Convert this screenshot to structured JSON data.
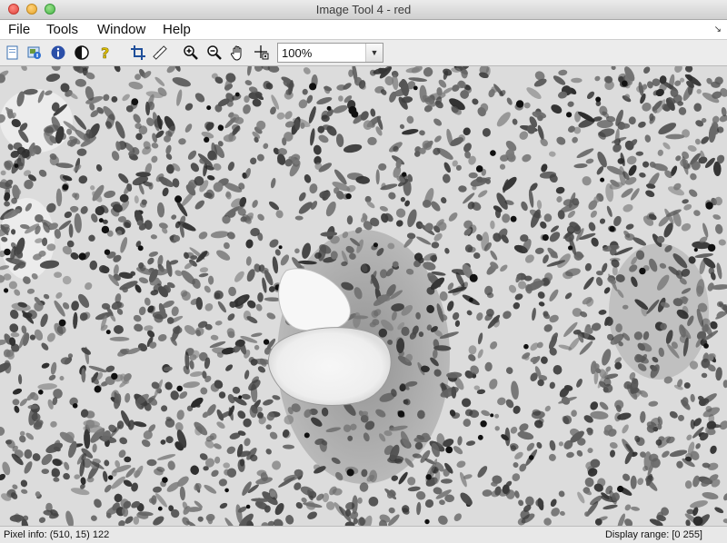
{
  "window": {
    "title": "Image Tool 4 - red"
  },
  "menu": {
    "items": [
      "File",
      "Tools",
      "Window",
      "Help"
    ]
  },
  "toolbar": {
    "zoom": {
      "value": "100%"
    },
    "icons": [
      "new-figure-icon",
      "image-info-icon",
      "info-icon",
      "contrast-icon",
      "help-icon",
      "crop-icon",
      "measure-distance-icon",
      "zoom-in-icon",
      "zoom-out-icon",
      "pan-hand-icon",
      "pixel-region-icon"
    ]
  },
  "status": {
    "pixel_info": "Pixel info: (510, 15)  122",
    "display_range": "Display range: [0 255]"
  },
  "image": {
    "description_color": "#ffffff"
  }
}
